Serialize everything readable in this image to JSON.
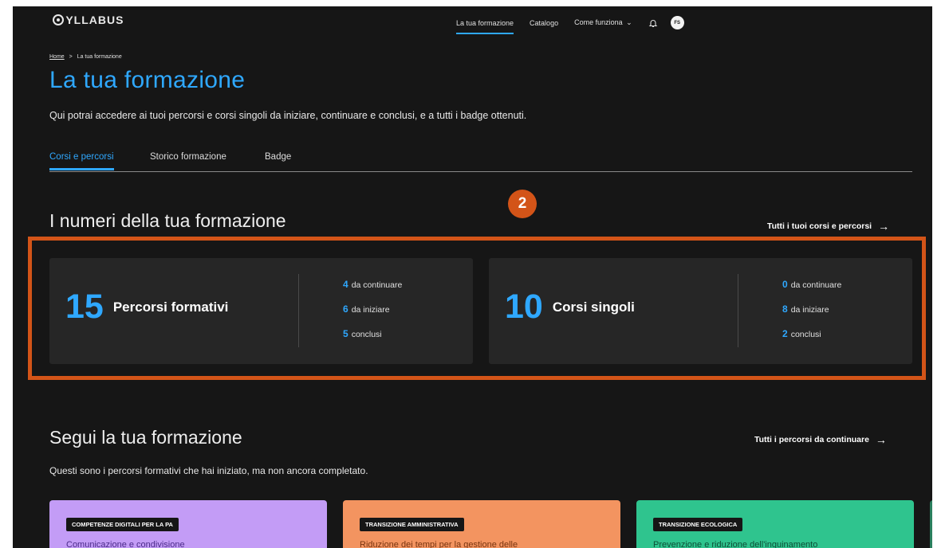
{
  "nav": {
    "logo": "SYLLABUS",
    "links": [
      "La tua formazione",
      "Catalogo",
      "Come funziona"
    ],
    "avatar_initials": "FS"
  },
  "breadcrumb": {
    "home": "Home",
    "separator": ">",
    "current": "La tua formazione"
  },
  "page": {
    "title": "La tua formazione",
    "intro": "Qui potrai accedere ai tuoi percorsi e corsi singoli da iniziare, continuare e conclusi, e a tutti i badge ottenuti."
  },
  "tabs": [
    "Corsi e percorsi",
    "Storico formazione",
    "Badge"
  ],
  "numbers": {
    "title": "I numeri della tua formazione",
    "link": "Tutti i tuoi corsi e percorsi",
    "step_marker": "2",
    "cards": [
      {
        "count": "15",
        "label": "Percorsi formativi",
        "items": [
          {
            "n": "4",
            "text": "da continuare"
          },
          {
            "n": "6",
            "text": "da iniziare"
          },
          {
            "n": "5",
            "text": "conclusi"
          }
        ]
      },
      {
        "count": "10",
        "label": "Corsi singoli",
        "items": [
          {
            "n": "0",
            "text": "da continuare"
          },
          {
            "n": "8",
            "text": "da iniziare"
          },
          {
            "n": "2",
            "text": "conclusi"
          }
        ]
      }
    ]
  },
  "follow": {
    "title": "Segui la tua formazione",
    "subtitle": "Questi sono i percorsi formativi che hai iniziato, ma non ancora completato.",
    "link": "Tutti i percorsi da continuare",
    "cards": [
      {
        "tag": "COMPETENZE DIGITALI PER LA PA",
        "title": "Comunicazione e condivisione",
        "color": "#c39cf6",
        "text_color": "#4b2a8a"
      },
      {
        "tag": "TRANSIZIONE AMMINISTRATIVA",
        "title": "Riduzione dei tempi per la gestione delle",
        "color": "#f39460",
        "text_color": "#7a3510"
      },
      {
        "tag": "TRANSIZIONE ECOLOGICA",
        "title": "Prevenzione e riduzione dell'inquinamento",
        "color": "#2fc48e",
        "text_color": "#0d4f37"
      }
    ]
  },
  "colors": {
    "accent": "#2fa8ff",
    "highlight": "#d35418",
    "background": "#161616",
    "card": "#262626"
  }
}
